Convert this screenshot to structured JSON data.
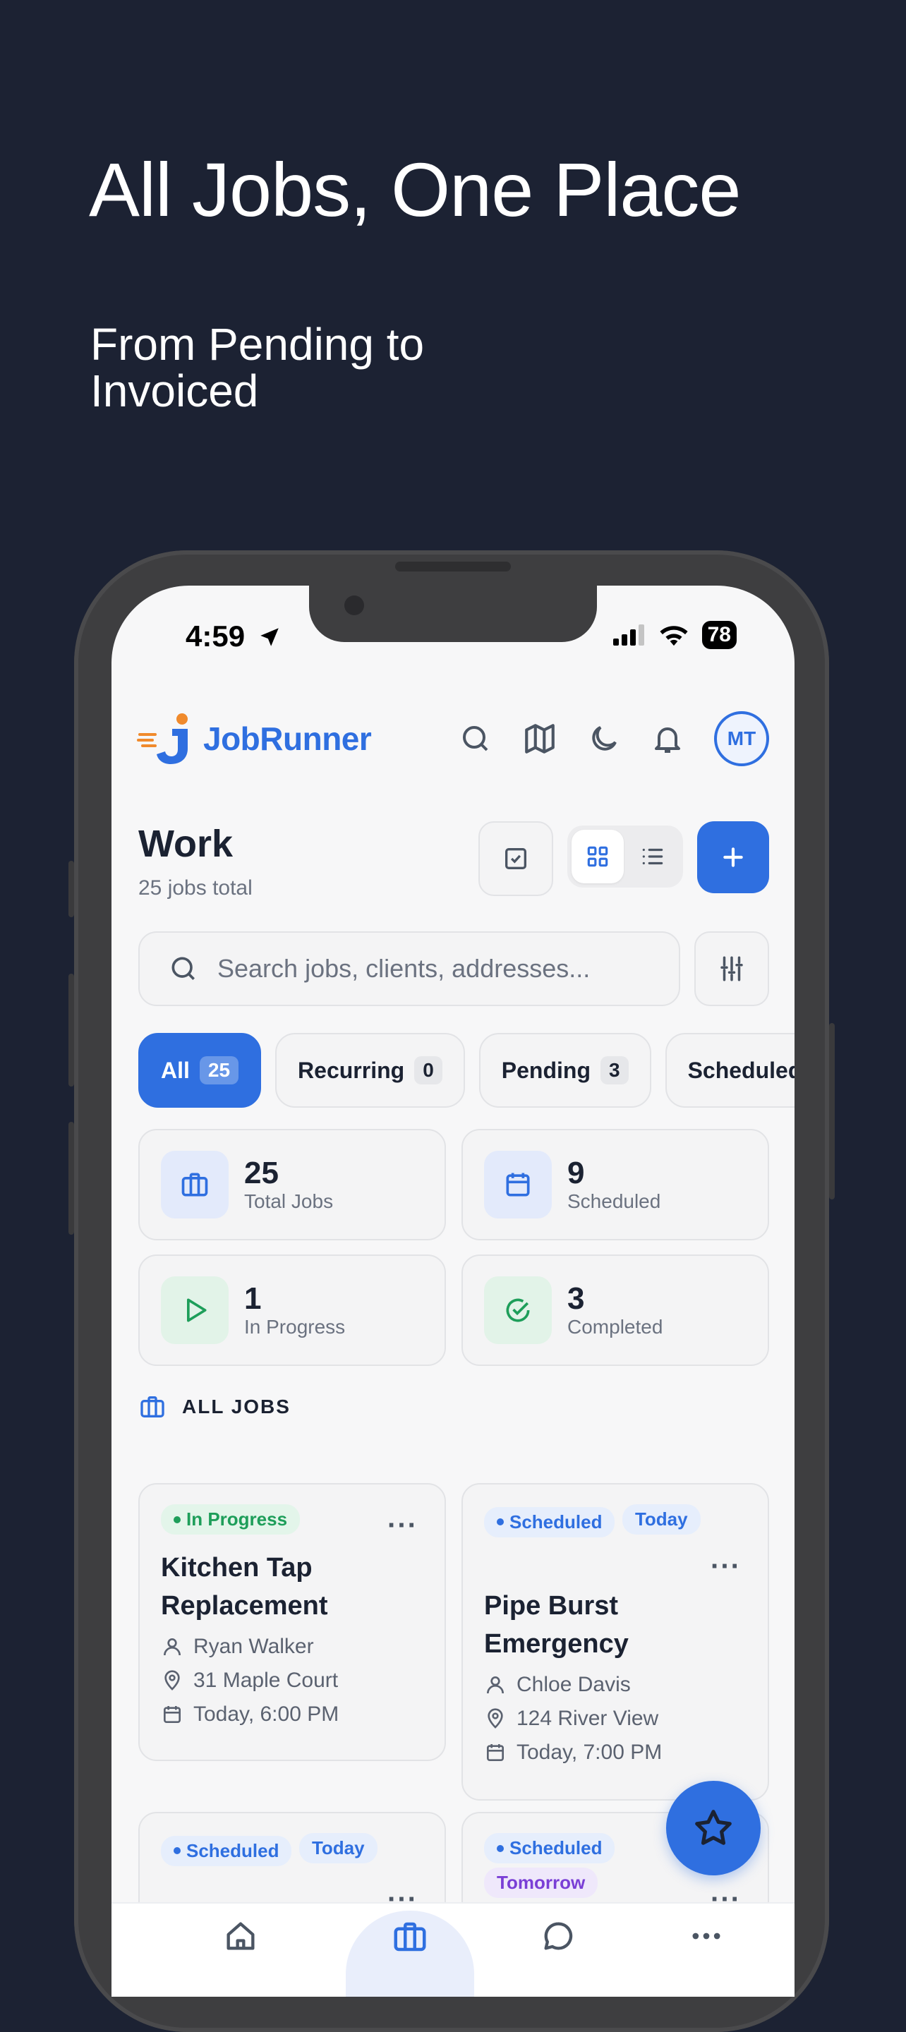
{
  "hero": {
    "title": "All Jobs, One Place",
    "subtitle": "From Pending to Invoiced"
  },
  "status_bar": {
    "time": "4:59",
    "battery": "78"
  },
  "app": {
    "brand": "JobRunner",
    "avatar_initials": "MT",
    "icons": [
      "search-icon",
      "map-icon",
      "moon-icon",
      "bell-icon"
    ]
  },
  "page": {
    "title": "Work",
    "count": "25 jobs total"
  },
  "search": {
    "placeholder": "Search jobs, clients, addresses..."
  },
  "filters": [
    {
      "label": "All",
      "count": "25",
      "active": true
    },
    {
      "label": "Recurring",
      "count": "0",
      "active": false
    },
    {
      "label": "Pending",
      "count": "3",
      "active": false
    },
    {
      "label": "Scheduled",
      "count": "",
      "active": false
    }
  ],
  "stats": [
    {
      "value": "25",
      "label": "Total Jobs"
    },
    {
      "value": "9",
      "label": "Scheduled"
    },
    {
      "value": "1",
      "label": "In Progress"
    },
    {
      "value": "3",
      "label": "Completed"
    }
  ],
  "section": {
    "heading": "ALL JOBS"
  },
  "jobs": [
    {
      "status": "In Progress",
      "tag": "",
      "title": "Kitchen Tap Replacement",
      "client": "Ryan Walker",
      "address": "31 Maple Court",
      "when": "Today, 6:00 PM"
    },
    {
      "status": "Scheduled",
      "tag": "Today",
      "title": "Pipe Burst Emergency",
      "client": "Chloe Davis",
      "address": "124 River View",
      "when": "Today, 7:00 PM"
    },
    {
      "status": "Scheduled",
      "tag": "Today"
    },
    {
      "status": "Scheduled",
      "tag": "Tomorrow"
    }
  ],
  "colors": {
    "accent": "#2f6fe0",
    "background": "#1c2233",
    "in_progress": "#1e9e5a",
    "tomorrow": "#7a3fd6"
  },
  "tabbar": {
    "icons": [
      "home-icon",
      "briefcase-icon",
      "chat-icon",
      "more-icon"
    ],
    "active": "briefcase-icon"
  }
}
